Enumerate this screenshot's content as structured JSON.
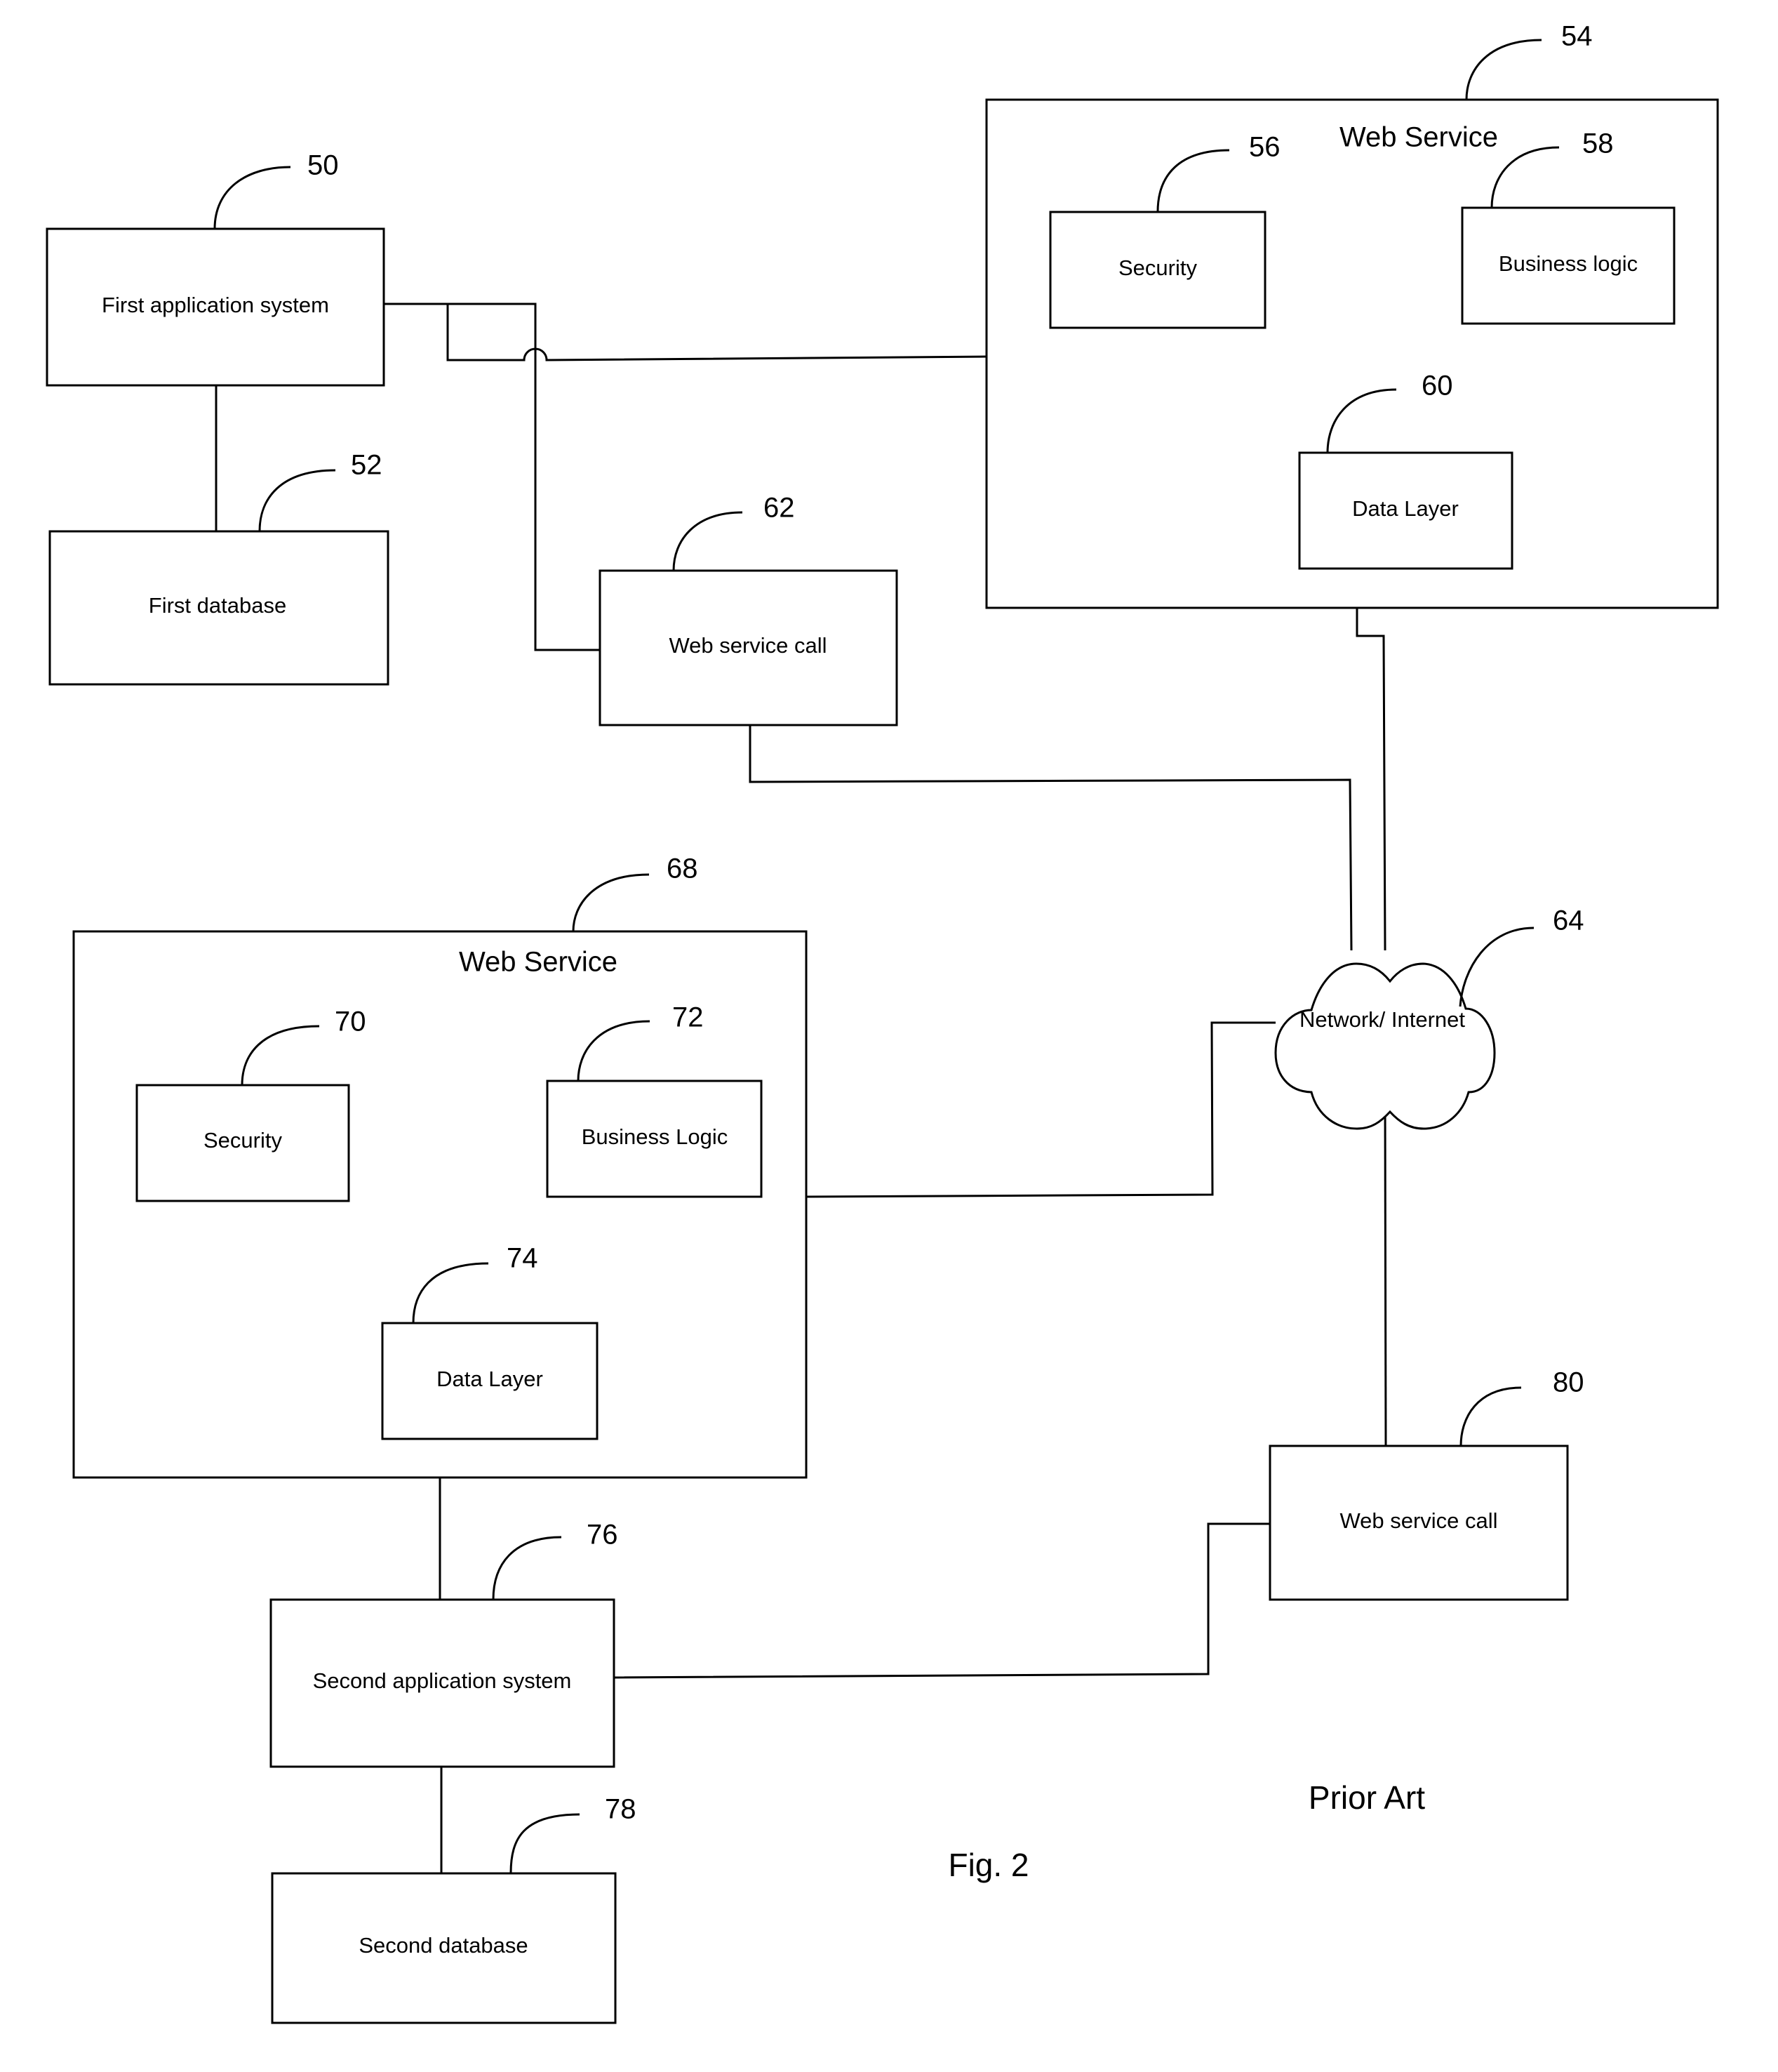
{
  "figure": {
    "caption": "Fig. 2",
    "note": "Prior Art"
  },
  "nodes": {
    "first_app": {
      "label": "First application system",
      "ref": "50"
    },
    "first_db": {
      "label": "First database",
      "ref": "52"
    },
    "web_service_1": {
      "label": "Web Service",
      "ref": "54"
    },
    "security_1": {
      "label": "Security",
      "ref": "56"
    },
    "business_1": {
      "label": "Business logic",
      "ref": "58"
    },
    "data_1": {
      "label": "Data Layer",
      "ref": "60"
    },
    "ws_call_1": {
      "label": "Web service call",
      "ref": "62"
    },
    "network": {
      "label": "Network/ Internet",
      "ref": "64"
    },
    "web_service_2": {
      "label": "Web Service",
      "ref": "68"
    },
    "security_2": {
      "label": "Security",
      "ref": "70"
    },
    "business_2": {
      "label": "Business Logic",
      "ref": "72"
    },
    "data_2": {
      "label": "Data Layer",
      "ref": "74"
    },
    "second_app": {
      "label": "Second application system",
      "ref": "76"
    },
    "second_db": {
      "label": "Second database",
      "ref": "78"
    },
    "ws_call_2": {
      "label": "Web service call",
      "ref": "80"
    }
  }
}
